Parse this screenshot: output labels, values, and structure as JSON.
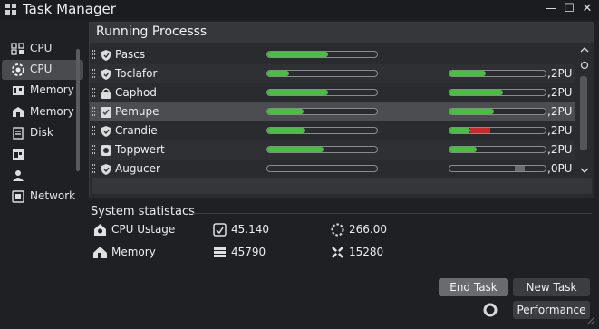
{
  "window": {
    "title": "Task Manager",
    "controls": [
      "minimize",
      "maximize",
      "close"
    ]
  },
  "sidebar": {
    "items": [
      {
        "label": "CPU",
        "icon": "cpu-chip-icon",
        "active": false
      },
      {
        "label": "CPU",
        "icon": "cpu-gear-icon",
        "active": true
      },
      {
        "label": "Memory",
        "icon": "memory-icon",
        "active": false
      },
      {
        "label": "Memory",
        "icon": "memory-puzzle-icon",
        "active": false
      },
      {
        "label": "Disk",
        "icon": "disk-icon",
        "active": false
      },
      {
        "label": "",
        "icon": "layout-icon",
        "active": false
      },
      {
        "label": "",
        "icon": "users-icon",
        "active": false
      },
      {
        "label": "Network",
        "icon": "network-icon",
        "active": false
      }
    ]
  },
  "processes": {
    "title": "Running Processs",
    "rows": [
      {
        "name": "Pascs",
        "icon": "shield-icon",
        "cpu": 0.55,
        "mem": null,
        "mem_red": null,
        "mem_gray": null,
        "pu": ""
      },
      {
        "name": "Toclafor",
        "icon": "shield-icon",
        "cpu": 0.2,
        "mem": 0.38,
        "mem_red": null,
        "mem_gray": null,
        "pu": ",2PU"
      },
      {
        "name": "Caphod",
        "icon": "lock-icon",
        "cpu": 0.55,
        "mem": 0.56,
        "mem_red": null,
        "mem_gray": null,
        "pu": ",2PU"
      },
      {
        "name": "Pemupe",
        "icon": "checkbox-icon",
        "cpu": 0.33,
        "mem": 0.46,
        "mem_red": null,
        "mem_gray": null,
        "pu": ",2PU"
      },
      {
        "name": "Crandie",
        "icon": "shield-icon",
        "cpu": 0.35,
        "mem": 0.22,
        "mem_red": [
          0.22,
          0.42
        ],
        "mem_gray": null,
        "pu": ",2PU"
      },
      {
        "name": "Toppwert",
        "icon": "tag-icon",
        "cpu": 0.51,
        "mem": 0.28,
        "mem_red": null,
        "mem_gray": null,
        "pu": ",2PU"
      },
      {
        "name": "Augucer",
        "icon": "shield-icon",
        "cpu": 0.0,
        "mem": 0.0,
        "mem_red": null,
        "mem_gray": [
          0.68,
          0.78
        ],
        "pu": ",0PU"
      }
    ]
  },
  "stats": {
    "title": "System statistacs",
    "items": [
      {
        "label": "CPU Ustage",
        "icon": "cpu-usage-icon"
      },
      {
        "label": "Memory",
        "icon": "memory-home-icon"
      },
      {
        "value": "45.140",
        "icon": "clipboard-icon"
      },
      {
        "value": "45790",
        "icon": "database-icon"
      },
      {
        "value": "266.00",
        "icon": "spinner-icon"
      },
      {
        "value": "15280",
        "icon": "network-x-icon"
      }
    ]
  },
  "buttons": {
    "end_task": "End Task",
    "new_task": "New Task",
    "performance": "Performance"
  },
  "colors": {
    "accent_green": "#44c23c",
    "alert_red": "#d62424",
    "background": "#1f2023"
  }
}
